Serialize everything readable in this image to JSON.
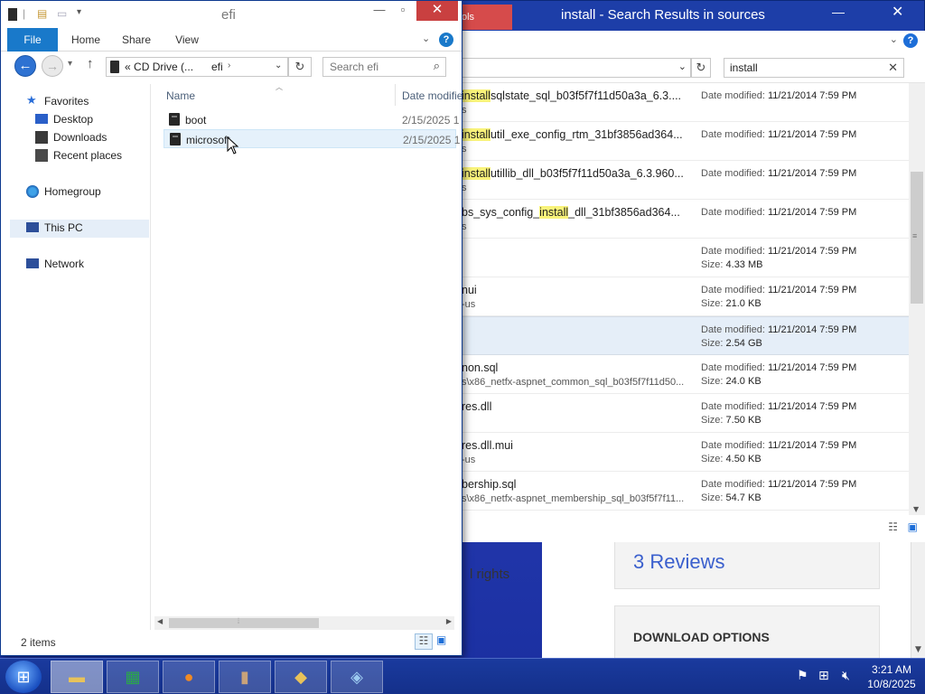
{
  "background_page": {
    "rights_text": "l rights",
    "reviews_label": "3 Reviews",
    "download_label": "DOWNLOAD OPTIONS"
  },
  "search_window": {
    "title": "install - Search Results in sources",
    "tools_tab": "ols",
    "search_value": "install",
    "results": [
      {
        "name_prefix": "",
        "name_hl": "install",
        "name_suffix": "sqlstate_sql_b03f5f7f11d50a3a_6.3....",
        "path": "s",
        "date_label": "Date modified: ",
        "date": "11/21/2014 7:59 PM",
        "size_label": "",
        "size": ""
      },
      {
        "name_prefix": "",
        "name_hl": "install",
        "name_suffix": "util_exe_config_rtm_31bf3856ad364...",
        "path": "s",
        "date_label": "Date modified: ",
        "date": "11/21/2014 7:59 PM",
        "size_label": "",
        "size": ""
      },
      {
        "name_prefix": "",
        "name_hl": "install",
        "name_suffix": "utillib_dll_b03f5f7f11d50a3a_6.3.960...",
        "path": "s",
        "date_label": "Date modified: ",
        "date": "11/21/2014 7:59 PM",
        "size_label": "",
        "size": ""
      },
      {
        "name_prefix": "bs_sys_config_",
        "name_hl": "install",
        "name_suffix": "_dll_31bf3856ad364...",
        "path": "s",
        "date_label": "Date modified: ",
        "date": "11/21/2014 7:59 PM",
        "size_label": "",
        "size": ""
      },
      {
        "name_prefix": "",
        "name_hl": "",
        "name_suffix": "",
        "path": "",
        "date_label": "Date modified: ",
        "date": "11/21/2014 7:59 PM",
        "size_label": "Size: ",
        "size": "4.33 MB"
      },
      {
        "name_prefix": "nui",
        "name_hl": "",
        "name_suffix": "",
        "path": "-us",
        "date_label": "Date modified: ",
        "date": "11/21/2014 7:59 PM",
        "size_label": "Size: ",
        "size": "21.0 KB"
      },
      {
        "name_prefix": "",
        "name_hl": "",
        "name_suffix": "",
        "path": "",
        "date_label": "Date modified: ",
        "date": "11/21/2014 7:59 PM",
        "size_label": "Size: ",
        "size": "2.54 GB"
      },
      {
        "name_prefix": "non.sql",
        "name_hl": "",
        "name_suffix": "",
        "path": "s\\x86_netfx-aspnet_common_sql_b03f5f7f11d50...",
        "date_label": "Date modified: ",
        "date": "11/21/2014 7:59 PM",
        "size_label": "Size: ",
        "size": "24.0 KB"
      },
      {
        "name_prefix": "res.dll",
        "name_hl": "",
        "name_suffix": "",
        "path": "",
        "date_label": "Date modified: ",
        "date": "11/21/2014 7:59 PM",
        "size_label": "Size: ",
        "size": "7.50 KB"
      },
      {
        "name_prefix": "res.dll.mui",
        "name_hl": "",
        "name_suffix": "",
        "path": "-us",
        "date_label": "Date modified: ",
        "date": "11/21/2014 7:59 PM",
        "size_label": "Size: ",
        "size": "4.50 KB"
      },
      {
        "name_prefix": "bership.sql",
        "name_hl": "",
        "name_suffix": "",
        "path": "s\\x86_netfx-aspnet_membership_sql_b03f5f7f11...",
        "date_label": "Date modified: ",
        "date": "11/21/2014 7:59 PM",
        "size_label": "Size: ",
        "size": "54.7 KB"
      }
    ],
    "selected_index": 6
  },
  "efi_window": {
    "title": "efi",
    "ribbon_tabs": {
      "file": "File",
      "home": "Home",
      "share": "Share",
      "view": "View"
    },
    "address": {
      "prefix": "«",
      "drive": "CD Drive (...",
      "folder": "efi"
    },
    "search_placeholder": "Search efi",
    "nav_pane": {
      "favorites": "Favorites",
      "desktop": "Desktop",
      "downloads": "Downloads",
      "recent": "Recent places",
      "homegroup": "Homegroup",
      "this_pc": "This PC",
      "network": "Network"
    },
    "columns": {
      "name": "Name",
      "date": "Date modifie"
    },
    "files": [
      {
        "name": "boot",
        "date": "2/15/2025 1"
      },
      {
        "name": "microsoft",
        "date": "2/15/2025 1"
      }
    ],
    "status": "2 items"
  },
  "taskbar": {
    "time": "3:21 AM",
    "date": "10/8/2025"
  },
  "colors": {
    "accent": "#1979ca",
    "highlight": "#f9f37a",
    "close_red": "#c94040",
    "desktop_blue": "#1d3ea8"
  }
}
